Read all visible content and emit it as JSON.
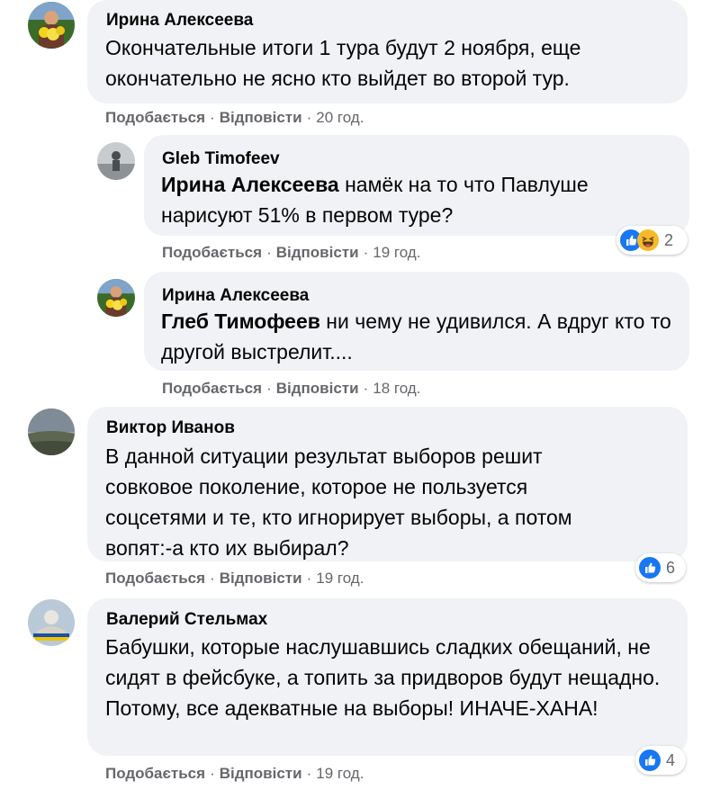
{
  "comments": [
    {
      "author": "Ирина Алексеева",
      "text": "Окончательные итоги 1 тура будут 2 ноября, еще окончательно не ясно кто выйдет во второй тур.",
      "like": "Подобається",
      "reply": "Відповісти",
      "time": "20 год.",
      "avatar": "flowers-avatar-icon"
    },
    {
      "author": "Gleb Timofeev",
      "mention": "Ирина Алексеева",
      "text": "намёк на то что Павлуше нарисуют 51% в первом туре?",
      "like": "Подобається",
      "reply": "Відповісти",
      "time": "19 год.",
      "reactions": {
        "count": "2",
        "icons": [
          "like-icon",
          "haha-icon"
        ]
      },
      "avatar": "person-avatar-icon"
    },
    {
      "author": "Ирина Алексеева",
      "mention": "Глеб Тимофеев",
      "text": "ни чему не удивился. А вдруг кто то другой выстрелит....",
      "like": "Подобається",
      "reply": "Відповісти",
      "time": "18 год.",
      "avatar": "flowers-avatar-icon"
    },
    {
      "author": "Виктор Иванов",
      "text": "В данной ситуации результат выборов решит совковое поколение, которое не пользуется соцсетями и те, кто игнорирует выборы, а потом вопят:-а кто их выбирал?",
      "like": "Подобається",
      "reply": "Відповісти",
      "time": "19 год.",
      "reactions": {
        "count": "6",
        "icons": [
          "like-icon"
        ]
      },
      "avatar": "landscape-avatar-icon"
    },
    {
      "author": "Валерий Стельмах",
      "text": "Бабушки, которые наслушавшись сладких обещаний, не сидят в фейсбуке, а топить за придворов будут нещадно. Потому, все адекватные на выборы! ИНАЧЕ-ХАНА!",
      "like": "Подобається",
      "reply": "Відповісти",
      "time": "19 год.",
      "reactions": {
        "count": "4",
        "icons": [
          "like-icon"
        ]
      },
      "avatar": "badge-avatar-icon"
    }
  ],
  "colors": {
    "bubble": "#f0f2f5",
    "meta": "#65676b",
    "like_blue": "#1877f2",
    "haha_yellow": "#f7b928"
  }
}
